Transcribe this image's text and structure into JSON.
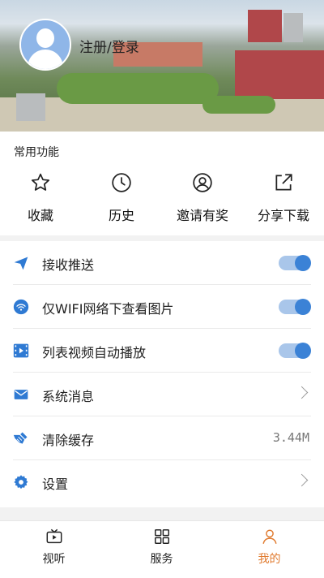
{
  "header": {
    "login_label": "注册/登录"
  },
  "common": {
    "title": "常用功能",
    "items": [
      {
        "label": "收藏",
        "icon": "star-icon"
      },
      {
        "label": "历史",
        "icon": "clock-icon"
      },
      {
        "label": "邀请有奖",
        "icon": "user-circle-icon"
      },
      {
        "label": "分享下载",
        "icon": "share-icon"
      }
    ]
  },
  "settings": [
    {
      "label": "接收推送",
      "icon": "send-icon",
      "control": "toggle",
      "on": true
    },
    {
      "label": "仅WIFI网络下查看图片",
      "icon": "wifi-icon",
      "control": "toggle",
      "on": true
    },
    {
      "label": "列表视频自动播放",
      "icon": "video-icon",
      "control": "toggle",
      "on": true
    },
    {
      "label": "系统消息",
      "icon": "mail-icon",
      "control": "chevron"
    },
    {
      "label": "清除缓存",
      "icon": "broom-icon",
      "control": "value",
      "value": "3.44M"
    },
    {
      "label": "设置",
      "icon": "gear-icon",
      "control": "chevron"
    }
  ],
  "nav": [
    {
      "label": "视听",
      "icon": "tv-icon",
      "active": false
    },
    {
      "label": "服务",
      "icon": "grid-icon",
      "active": false
    },
    {
      "label": "我的",
      "icon": "person-icon",
      "active": true
    }
  ],
  "colors": {
    "accent": "#3b82d6",
    "active_tab": "#e07a2e",
    "toggle_track": "#a9c6ea"
  }
}
